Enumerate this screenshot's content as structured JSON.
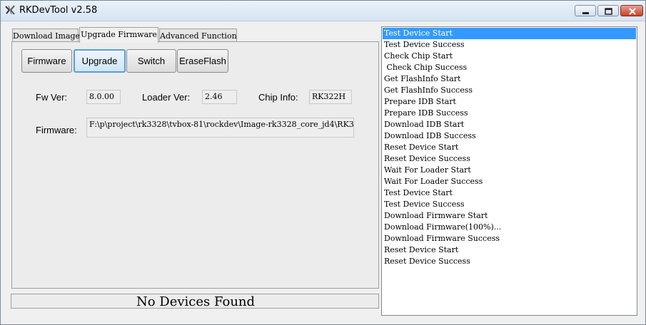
{
  "window": {
    "title": "RKDevTool v2.58"
  },
  "tabs": [
    {
      "label": "Download Image"
    },
    {
      "label": "Upgrade Firmware"
    },
    {
      "label": "Advanced Function"
    }
  ],
  "buttons": {
    "firmware": "Firmware",
    "upgrade": "Upgrade",
    "switch": "Switch",
    "eraseflash": "EraseFlash"
  },
  "info": {
    "fw_ver_label": "Fw Ver:",
    "fw_ver_value": "8.0.00",
    "loader_ver_label": "Loader Ver:",
    "loader_ver_value": "2.46",
    "chip_info_label": "Chip Info:",
    "chip_info_value": "RK322H",
    "firmware_label": "Firmware:",
    "firmware_path": "F:\\p\\project\\rk3328\\tvbox-81\\rockdev\\Image-rk3328_core_jd4\\RK3"
  },
  "status": {
    "text": "No Devices Found"
  },
  "log": [
    "Test Device Start",
    "Test Device Success",
    "Check Chip Start",
    " Check Chip Success",
    "Get FlashInfo Start",
    "Get FlashInfo Success",
    "Prepare IDB Start",
    "Prepare IDB Success",
    "Download IDB Start",
    "Download IDB Success",
    "Reset Device Start",
    "Reset Device Success",
    "Wait For Loader Start",
    "Wait For Loader Success",
    "Test Device Start",
    "Test Device Success",
    "Download Firmware Start",
    "Download Firmware(100%)...",
    "Download Firmware Success",
    "Reset Device Start",
    "Reset Device Success"
  ],
  "colors": {
    "selection": "#3399ff",
    "focus_border": "#5a9ed8"
  }
}
